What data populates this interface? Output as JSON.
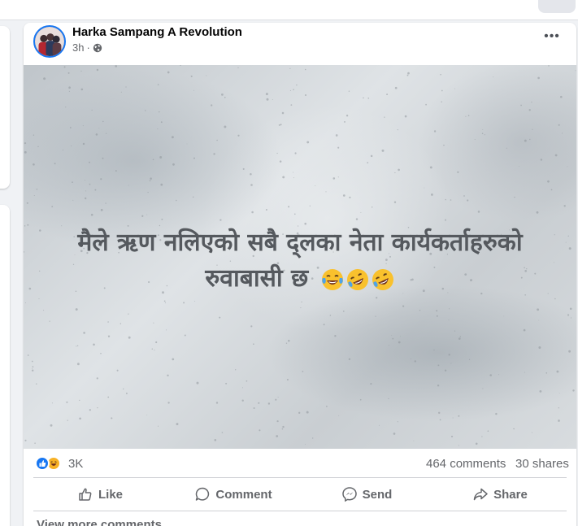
{
  "post": {
    "author": "Harka Sampang A Revolution",
    "time": "3h",
    "separator": "·",
    "more_label": "•••",
    "image_text_line1": "मैले ऋण नलिएको सबै द्लका नेता कार्यकर्ताहरुको",
    "image_text_line2": "रुवाबासी छ",
    "image_emojis": [
      "face-with-tears-of-joy-icon",
      "rolling-on-floor-laughing-icon",
      "rolling-on-floor-laughing-icon"
    ]
  },
  "stats": {
    "reactions_count": "3K",
    "reaction_icons": [
      "like-reaction-icon",
      "haha-reaction-icon"
    ],
    "comments": "464 comments",
    "shares": "30 shares"
  },
  "actions": {
    "like": "Like",
    "comment": "Comment",
    "send": "Send",
    "share": "Share"
  },
  "footer": {
    "view_more": "View more comments"
  },
  "colors": {
    "brand_blue": "#1877f2",
    "secondary_text": "#65676b",
    "image_text": "#55595e",
    "haha_yellow": "#f7b125"
  }
}
